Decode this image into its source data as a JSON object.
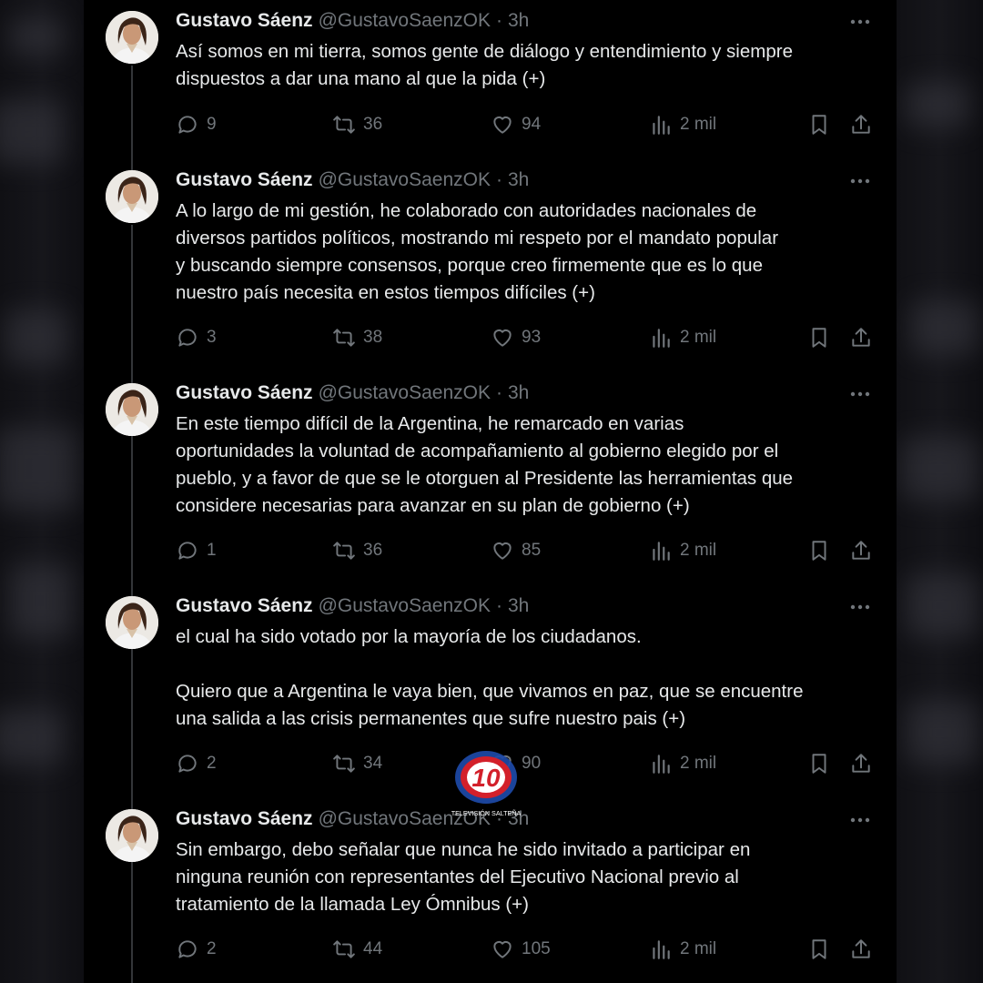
{
  "tweets": [
    {
      "name": "Gustavo Sáenz",
      "handle": "@GustavoSaenzOK",
      "sep": "·",
      "time": "3h",
      "text": "Así somos en mi tierra, somos gente de diálogo y entendimiento y siempre\ndispuestos a dar una mano al que la pida (+)",
      "replies": "9",
      "retweets": "36",
      "likes": "94",
      "views": "2 mil"
    },
    {
      "name": "Gustavo Sáenz",
      "handle": "@GustavoSaenzOK",
      "sep": "·",
      "time": "3h",
      "text": "A lo largo de mi gestión, he colaborado con autoridades nacionales de\ndiversos partidos políticos, mostrando mi respeto por el mandato popular\ny buscando siempre consensos, porque creo firmemente que es lo que\nnuestro país necesita en estos tiempos difíciles (+)",
      "replies": "3",
      "retweets": "38",
      "likes": "93",
      "views": "2 mil"
    },
    {
      "name": "Gustavo Sáenz",
      "handle": "@GustavoSaenzOK",
      "sep": "·",
      "time": "3h",
      "text": "En este tiempo difícil de la Argentina, he remarcado en varias\noportunidades la voluntad de acompañamiento al gobierno elegido por el\npueblo, y a favor de que se le otorguen al Presidente las herramientas que\nconsidere necesarias para avanzar en su plan de gobierno (+)",
      "replies": "1",
      "retweets": "36",
      "likes": "85",
      "views": "2 mil"
    },
    {
      "name": "Gustavo Sáenz",
      "handle": "@GustavoSaenzOK",
      "sep": "·",
      "time": "3h",
      "text": "el cual ha sido votado por la mayoría de los ciudadanos.\n\nQuiero que a Argentina le vaya bien, que vivamos en paz, que se encuentre\nuna salida a las crisis permanentes que sufre nuestro pais (+)",
      "replies": "2",
      "retweets": "34",
      "likes": "90",
      "views": "2 mil"
    },
    {
      "name": "Gustavo Sáenz",
      "handle": "@GustavoSaenzOK",
      "sep": "·",
      "time": "3h",
      "text": "Sin embargo, debo señalar que nunca he sido invitado a participar en\nninguna reunión con representantes del Ejecutivo Nacional previo al\ntratamiento de la llamada Ley Ómnibus (+)",
      "replies": "2",
      "retweets": "44",
      "likes": "105",
      "views": "2 mil"
    }
  ],
  "watermark": {
    "brand": "10",
    "caption": "TELEVISIÓN SALTEÑA"
  },
  "colors": {
    "background": "#000000",
    "text": "#e7e9ea",
    "muted": "#71767b",
    "thread_line": "#333639",
    "logo_red": "#d3202a",
    "logo_blue": "#1d4aa8"
  }
}
